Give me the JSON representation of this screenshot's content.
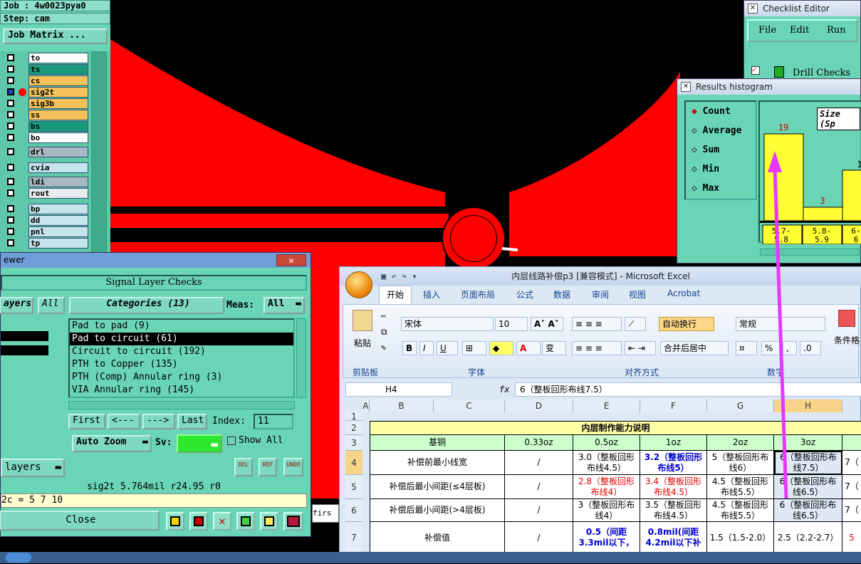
{
  "left": {
    "job": "Job : 4w0023pya0",
    "step": "Step: cam",
    "job_matrix": "Job Matrix ...",
    "layers": [
      {
        "name": "to",
        "color": "#ffffff",
        "mark": "⬋"
      },
      {
        "name": "ts",
        "color": "#1a9a7a",
        "mark": ""
      },
      {
        "name": "cs",
        "color": "#f5c15a",
        "mark": ""
      },
      {
        "name": "sig2t",
        "color": "#f5c15a",
        "mark": "⊞"
      },
      {
        "name": "sig3b",
        "color": "#f5c15a",
        "mark": ""
      },
      {
        "name": "ss",
        "color": "#f5c15a",
        "mark": ""
      },
      {
        "name": "bs",
        "color": "#1a9a7a",
        "mark": ""
      },
      {
        "name": "bo",
        "color": "#ffffff",
        "mark": "⬋"
      },
      {
        "name": "drl",
        "color": "#a7b8c0",
        "mark": ""
      },
      {
        "name": "cvia",
        "color": "#c5e4ec",
        "mark": ""
      },
      {
        "name": "ldi",
        "color": "#a7b8c0",
        "mark": ""
      },
      {
        "name": "rout",
        "color": "#e8ecee",
        "mark": ""
      },
      {
        "name": "bp",
        "color": "#c5e4ec",
        "mark": ""
      },
      {
        "name": "dd",
        "color": "#c5e4ec",
        "mark": "⬋"
      },
      {
        "name": "pnl",
        "color": "#c5e4ec",
        "mark": "⬋"
      },
      {
        "name": "tp",
        "color": "#c5e4ec",
        "mark": ""
      }
    ]
  },
  "signal": {
    "window_title": "ewer",
    "header": "Signal Layer Checks",
    "layers_label": "ayers",
    "all_label": "All",
    "categories_label": "Categories (13)",
    "meas_label": "Meas:",
    "meas_value": "All",
    "categories": [
      "Pad to pad (9)",
      "Pad to circuit (61)",
      "Circuit to circuit (192)",
      "PTH to Copper (135)",
      "PTH (Comp) Annular ring (3)",
      "VIA Annular ring (145)"
    ],
    "first": "First",
    "prev": "<---",
    "next": "--->",
    "last": "Last",
    "index_label": "Index:",
    "index_value": "11",
    "auto_zoom": "Auto Zoom",
    "sv_label": "Sv:",
    "show_all": "Show All",
    "del": "DEL",
    "ref": "REF",
    "undo": "UNDO",
    "layers_btn": "layers",
    "status": "sig2t 5.764mil  r24.95  r0",
    "formula": "2c = 5 7 10",
    "close": "Close",
    "first_tag": "firs"
  },
  "checklist": {
    "title": "Checklist Editor",
    "menu": [
      "File",
      "Edit",
      "Run"
    ],
    "item": "Drill Checks"
  },
  "histogram": {
    "title": "Results histogram",
    "options": [
      "Count",
      "Average",
      "Sum",
      "Min",
      "Max"
    ],
    "size_label": "Size (Sp",
    "bars_text": [
      "19",
      "3",
      "1"
    ],
    "bins": [
      "5.7-\n5.8",
      "5.8-\n5.9",
      "6-\n6"
    ]
  },
  "excel": {
    "title": "内层线路补偿p3  [兼容模式] - Microsoft Excel",
    "tabs": [
      "开始",
      "插入",
      "页面布局",
      "公式",
      "数据",
      "审阅",
      "视图",
      "Acrobat"
    ],
    "paste": "粘贴",
    "font_name": "宋体",
    "font_size": "10",
    "wrap": "自动换行",
    "merge": "合并后居中",
    "number_format": "常规",
    "percent": "%",
    "cond_format": "条件格",
    "groups": [
      "剪贴板",
      "字体",
      "对齐方式",
      "数字"
    ],
    "cell_ref": "H4",
    "fx": "fx",
    "formula": "6（整板回形布线7.5）",
    "col_headers": [
      "A",
      "B",
      "C",
      "D",
      "E",
      "F",
      "G",
      "H"
    ],
    "row_headers": [
      "1",
      "2",
      "3",
      "4",
      "5",
      "6",
      "7"
    ],
    "table_title": "内层制作能力说明",
    "header_row": [
      "基铜",
      "0.33oz",
      "0.5oz",
      "1oz",
      "2oz",
      "3oz"
    ],
    "rows": [
      {
        "label": "补偿前最小线宽",
        "cells": [
          "/",
          "3.0（整板回形布线4.5）",
          "3.2（整板回形布线5）",
          "5（整板回形布线6）",
          "6（整板回形布线7.5）",
          "7（"
        ]
      },
      {
        "label": "补偿后最小间距(≤4层板)",
        "cells": [
          "/",
          "2.8（整板回形布线4）",
          "3.4（整板回形布线4.5）",
          "4.5（整板回形布线5.5）",
          "6（整板回形布线6.5）",
          "7（"
        ]
      },
      {
        "label": "补偿后最小间距(>4层板)",
        "cells": [
          "/",
          "3（整板回形布线4）",
          "3.5（整板回形布线4.5）",
          "4.5（整板回形布线5.5）",
          "6（整板回形布线6.5）",
          "7（"
        ]
      },
      {
        "label": "补偿值",
        "cells": [
          "/",
          "0.5（间距3.3mil以下，",
          "0.8mil(间距4.2mil以下补",
          "1.5（1.5-2.0）",
          "2.5（2.2-2.7）",
          "5"
        ]
      }
    ]
  },
  "colors": {
    "teal": "#6ad5b5",
    "red": "#ff0000",
    "yellow": "#ffff33",
    "magenta": "#e639ff"
  }
}
